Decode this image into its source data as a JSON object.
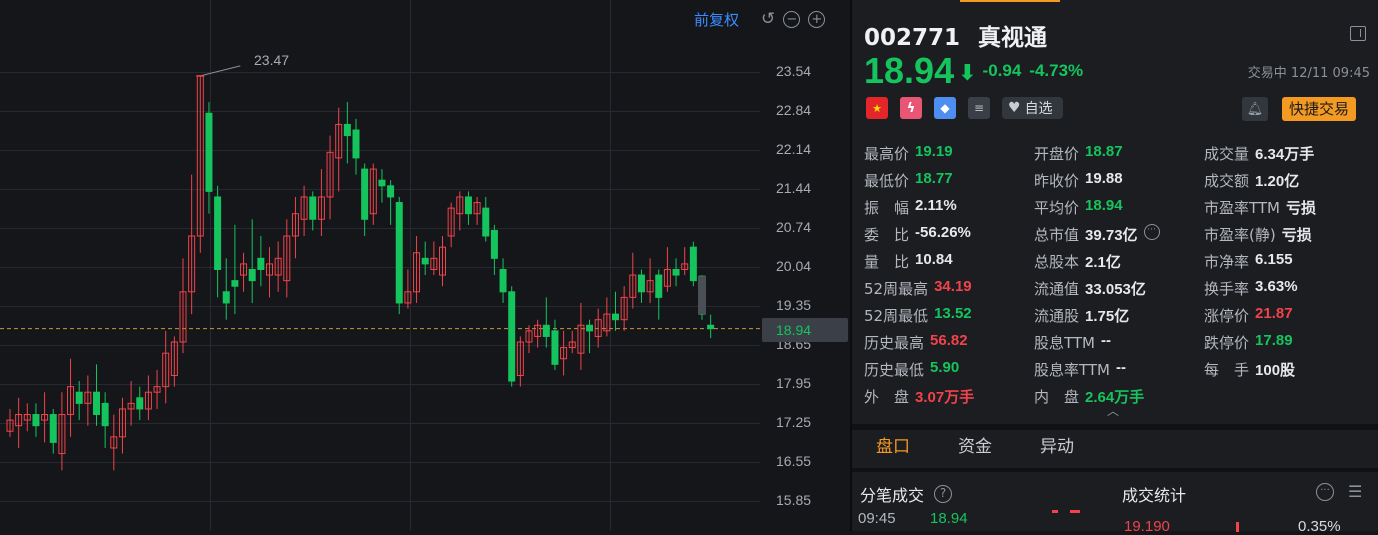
{
  "toolbar": {
    "adjust_label": "前复权",
    "undo_icon": "undo-icon",
    "zoom_out_icon": "zoom-out-icon",
    "zoom_in_icon": "zoom-in-icon"
  },
  "chart": {
    "y_ticks": [
      "23.54",
      "22.84",
      "22.14",
      "21.44",
      "20.74",
      "20.04",
      "19.35",
      "18.65",
      "17.95",
      "17.25",
      "16.55",
      "15.85"
    ],
    "current_price_tag": "18.94",
    "high_annotation": "23.47"
  },
  "chart_data": {
    "type": "candlestick",
    "ylim": [
      15.85,
      23.54
    ],
    "last_price": 18.94,
    "max_high": 23.47,
    "candles": [
      {
        "o": 17.1,
        "c": 17.3,
        "h": 17.5,
        "l": 17.0
      },
      {
        "o": 17.2,
        "c": 17.4,
        "h": 17.7,
        "l": 16.8
      },
      {
        "o": 17.3,
        "c": 17.4,
        "h": 17.6,
        "l": 17.1
      },
      {
        "o": 17.4,
        "c": 17.2,
        "h": 17.6,
        "l": 17.0
      },
      {
        "o": 17.3,
        "c": 17.4,
        "h": 17.8,
        "l": 16.9
      },
      {
        "o": 17.4,
        "c": 16.9,
        "h": 17.5,
        "l": 16.7
      },
      {
        "o": 16.7,
        "c": 17.4,
        "h": 17.8,
        "l": 16.4
      },
      {
        "o": 17.4,
        "c": 17.9,
        "h": 18.4,
        "l": 17.0
      },
      {
        "o": 17.8,
        "c": 17.6,
        "h": 18.0,
        "l": 17.3
      },
      {
        "o": 17.6,
        "c": 17.8,
        "h": 18.1,
        "l": 17.2
      },
      {
        "o": 17.8,
        "c": 17.4,
        "h": 18.3,
        "l": 17.2
      },
      {
        "o": 17.6,
        "c": 17.2,
        "h": 17.8,
        "l": 16.8
      },
      {
        "o": 16.8,
        "c": 17.0,
        "h": 17.4,
        "l": 16.4
      },
      {
        "o": 17.0,
        "c": 17.5,
        "h": 17.7,
        "l": 16.7
      },
      {
        "o": 17.5,
        "c": 17.6,
        "h": 18.0,
        "l": 17.2
      },
      {
        "o": 17.7,
        "c": 17.5,
        "h": 17.9,
        "l": 17.3
      },
      {
        "o": 17.5,
        "c": 17.8,
        "h": 18.1,
        "l": 17.3
      },
      {
        "o": 17.8,
        "c": 17.9,
        "h": 18.2,
        "l": 17.5
      },
      {
        "o": 17.9,
        "c": 18.5,
        "h": 18.9,
        "l": 17.6
      },
      {
        "o": 18.1,
        "c": 18.7,
        "h": 18.8,
        "l": 17.9
      },
      {
        "o": 18.7,
        "c": 19.6,
        "h": 20.2,
        "l": 18.5
      },
      {
        "o": 19.6,
        "c": 20.6,
        "h": 21.7,
        "l": 19.2
      },
      {
        "o": 20.6,
        "c": 23.47,
        "h": 23.47,
        "l": 20.3
      },
      {
        "o": 22.8,
        "c": 21.4,
        "h": 23.0,
        "l": 21.0
      },
      {
        "o": 21.3,
        "c": 20.0,
        "h": 21.5,
        "l": 19.5
      },
      {
        "o": 19.6,
        "c": 19.4,
        "h": 20.2,
        "l": 19.1
      },
      {
        "o": 19.8,
        "c": 19.7,
        "h": 20.8,
        "l": 19.2
      },
      {
        "o": 19.9,
        "c": 20.1,
        "h": 20.3,
        "l": 19.6
      },
      {
        "o": 20.0,
        "c": 19.8,
        "h": 20.9,
        "l": 19.4
      },
      {
        "o": 20.2,
        "c": 20.0,
        "h": 20.6,
        "l": 19.7
      },
      {
        "o": 19.9,
        "c": 20.1,
        "h": 20.4,
        "l": 19.5
      },
      {
        "o": 19.9,
        "c": 20.2,
        "h": 20.5,
        "l": 19.6
      },
      {
        "o": 19.8,
        "c": 20.6,
        "h": 20.9,
        "l": 19.5
      },
      {
        "o": 20.6,
        "c": 21.0,
        "h": 21.3,
        "l": 20.2
      },
      {
        "o": 20.9,
        "c": 21.3,
        "h": 21.5,
        "l": 20.6
      },
      {
        "o": 21.3,
        "c": 20.9,
        "h": 21.4,
        "l": 20.7
      },
      {
        "o": 20.9,
        "c": 21.3,
        "h": 21.8,
        "l": 20.6
      },
      {
        "o": 21.3,
        "c": 22.1,
        "h": 22.4,
        "l": 20.9
      },
      {
        "o": 22.0,
        "c": 22.6,
        "h": 22.9,
        "l": 21.4
      },
      {
        "o": 22.6,
        "c": 22.4,
        "h": 23.0,
        "l": 21.9
      },
      {
        "o": 22.5,
        "c": 22.0,
        "h": 22.7,
        "l": 21.7
      },
      {
        "o": 21.8,
        "c": 20.9,
        "h": 21.9,
        "l": 20.6
      },
      {
        "o": 21.0,
        "c": 21.8,
        "h": 21.9,
        "l": 20.8
      },
      {
        "o": 21.6,
        "c": 21.5,
        "h": 21.8,
        "l": 21.2
      },
      {
        "o": 21.5,
        "c": 21.3,
        "h": 21.6,
        "l": 20.8
      },
      {
        "o": 21.2,
        "c": 19.4,
        "h": 21.3,
        "l": 19.2
      },
      {
        "o": 19.4,
        "c": 19.6,
        "h": 20.0,
        "l": 19.3
      },
      {
        "o": 19.6,
        "c": 20.3,
        "h": 20.6,
        "l": 19.4
      },
      {
        "o": 20.2,
        "c": 20.1,
        "h": 20.5,
        "l": 19.9
      },
      {
        "o": 20.0,
        "c": 20.2,
        "h": 20.5,
        "l": 19.9
      },
      {
        "o": 19.9,
        "c": 20.4,
        "h": 20.6,
        "l": 19.7
      },
      {
        "o": 20.6,
        "c": 21.1,
        "h": 21.2,
        "l": 20.4
      },
      {
        "o": 21.0,
        "c": 21.3,
        "h": 21.4,
        "l": 20.7
      },
      {
        "o": 21.3,
        "c": 21.0,
        "h": 21.4,
        "l": 20.8
      },
      {
        "o": 21.0,
        "c": 21.2,
        "h": 21.3,
        "l": 20.8
      },
      {
        "o": 21.1,
        "c": 20.6,
        "h": 21.3,
        "l": 20.5
      },
      {
        "o": 20.7,
        "c": 20.2,
        "h": 20.8,
        "l": 19.9
      },
      {
        "o": 20.0,
        "c": 19.6,
        "h": 20.2,
        "l": 19.4
      },
      {
        "o": 19.6,
        "c": 18.0,
        "h": 19.7,
        "l": 17.9
      },
      {
        "o": 18.1,
        "c": 18.7,
        "h": 18.8,
        "l": 17.9
      },
      {
        "o": 18.7,
        "c": 18.9,
        "h": 19.0,
        "l": 18.5
      },
      {
        "o": 18.8,
        "c": 19.0,
        "h": 19.1,
        "l": 18.6
      },
      {
        "o": 19.0,
        "c": 18.8,
        "h": 19.5,
        "l": 18.6
      },
      {
        "o": 18.9,
        "c": 18.3,
        "h": 19.1,
        "l": 18.2
      },
      {
        "o": 18.4,
        "c": 18.6,
        "h": 18.9,
        "l": 18.1
      },
      {
        "o": 18.6,
        "c": 18.7,
        "h": 18.9,
        "l": 18.5
      },
      {
        "o": 18.5,
        "c": 19.0,
        "h": 19.4,
        "l": 18.2
      },
      {
        "o": 19.0,
        "c": 18.9,
        "h": 19.1,
        "l": 18.5
      },
      {
        "o": 18.8,
        "c": 19.1,
        "h": 19.3,
        "l": 18.6
      },
      {
        "o": 18.9,
        "c": 19.2,
        "h": 19.5,
        "l": 18.8
      },
      {
        "o": 19.2,
        "c": 19.1,
        "h": 19.6,
        "l": 18.9
      },
      {
        "o": 19.1,
        "c": 19.5,
        "h": 19.7,
        "l": 18.9
      },
      {
        "o": 19.5,
        "c": 19.9,
        "h": 20.3,
        "l": 19.3
      },
      {
        "o": 19.9,
        "c": 19.6,
        "h": 20.0,
        "l": 19.4
      },
      {
        "o": 19.6,
        "c": 19.8,
        "h": 20.2,
        "l": 19.4
      },
      {
        "o": 19.9,
        "c": 19.5,
        "h": 20.0,
        "l": 19.1
      },
      {
        "o": 19.7,
        "c": 20.0,
        "h": 20.4,
        "l": 19.6
      },
      {
        "o": 20.0,
        "c": 19.9,
        "h": 20.2,
        "l": 19.7
      },
      {
        "o": 20.0,
        "c": 20.1,
        "h": 20.4,
        "l": 19.9
      },
      {
        "o": 20.4,
        "c": 19.8,
        "h": 20.5,
        "l": 19.7
      },
      {
        "o": 19.88,
        "c": 19.2,
        "h": 19.9,
        "l": 19.1
      },
      {
        "o": 19.0,
        "c": 18.94,
        "h": 19.19,
        "l": 18.77
      }
    ]
  },
  "stock": {
    "code": "002771",
    "name": "真视通",
    "price": "18.94",
    "arrow": "⬇",
    "change": "-0.94",
    "change_pct": "-4.73%",
    "status": "交易中 12/11 09:45",
    "watch_label": "自选",
    "quick_trade_label": "快捷交易"
  },
  "stats": [
    [
      {
        "l": "最高价",
        "v": "19.19",
        "c": "g"
      },
      {
        "l": "开盘价",
        "v": "18.87",
        "c": "g"
      },
      {
        "l": "成交量",
        "v": "6.34万手",
        "c": "w"
      }
    ],
    [
      {
        "l": "最低价",
        "v": "18.77",
        "c": "g"
      },
      {
        "l": "昨收价",
        "v": "19.88",
        "c": "w"
      },
      {
        "l": "成交额",
        "v": "1.20亿",
        "c": "w"
      }
    ],
    [
      {
        "l": "振　幅",
        "v": "2.11%",
        "c": "w"
      },
      {
        "l": "平均价",
        "v": "18.94",
        "c": "g"
      },
      {
        "l": "市盈率TTM",
        "v": "亏损",
        "c": "w"
      }
    ],
    [
      {
        "l": "委　比",
        "v": "-56.26%",
        "c": "w"
      },
      {
        "l": "总市值",
        "v": "39.73亿",
        "c": "w",
        "more": true
      },
      {
        "l": "市盈率(静)",
        "v": "亏损",
        "c": "w"
      }
    ],
    [
      {
        "l": "量　比",
        "v": "10.84",
        "c": "w"
      },
      {
        "l": "总股本",
        "v": "2.1亿",
        "c": "w"
      },
      {
        "l": "市净率",
        "v": "6.155",
        "c": "w"
      }
    ],
    [
      {
        "l": "52周最高",
        "v": "34.19",
        "c": "r"
      },
      {
        "l": "流通值",
        "v": "33.053亿",
        "c": "w"
      },
      {
        "l": "换手率",
        "v": "3.63%",
        "c": "w"
      }
    ],
    [
      {
        "l": "52周最低",
        "v": "13.52",
        "c": "g"
      },
      {
        "l": "流通股",
        "v": "1.75亿",
        "c": "w"
      },
      {
        "l": "涨停价",
        "v": "21.87",
        "c": "r"
      }
    ],
    [
      {
        "l": "历史最高",
        "v": "56.82",
        "c": "r"
      },
      {
        "l": "股息TTM",
        "v": "--",
        "c": "w"
      },
      {
        "l": "跌停价",
        "v": "17.89",
        "c": "g"
      }
    ],
    [
      {
        "l": "历史最低",
        "v": "5.90",
        "c": "g"
      },
      {
        "l": "股息率TTM",
        "v": "--",
        "c": "w"
      },
      {
        "l": "每　手",
        "v": "100股",
        "c": "w"
      }
    ],
    [
      {
        "l": "外　盘",
        "v": "3.07万手",
        "c": "r"
      },
      {
        "l": "内　盘",
        "v": "2.64万手",
        "c": "g"
      },
      {
        "l": "",
        "v": "",
        "c": "w"
      }
    ]
  ],
  "tabs": [
    "盘口",
    "资金",
    "异动"
  ],
  "sections": {
    "ticks_title": "分笔成交",
    "stats_title": "成交统计"
  },
  "bottom": {
    "time": "09:45",
    "tick_price": "18.94",
    "stat_price": "19.190",
    "stat_pct": "0.35%"
  }
}
